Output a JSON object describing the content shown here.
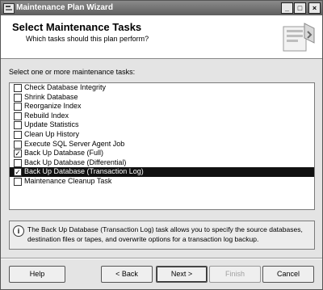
{
  "window": {
    "title": "Maintenance Plan Wizard"
  },
  "window_controls": {
    "minimize": "_",
    "maximize": "□",
    "close": "×"
  },
  "header": {
    "heading": "Select Maintenance Tasks",
    "subheading": "Which tasks should this plan perform?"
  },
  "tasks": {
    "instruction": "Select one or more maintenance tasks:",
    "items": [
      {
        "label": "Check Database Integrity",
        "checked": false
      },
      {
        "label": "Shrink Database",
        "checked": false
      },
      {
        "label": "Reorganize Index",
        "checked": false
      },
      {
        "label": "Rebuild Index",
        "checked": false
      },
      {
        "label": "Update Statistics",
        "checked": false
      },
      {
        "label": "Clean Up History",
        "checked": false
      },
      {
        "label": "Execute SQL Server Agent Job",
        "checked": false
      },
      {
        "label": "Back Up Database (Full)",
        "checked": true
      },
      {
        "label": "Back Up Database (Differential)",
        "checked": false
      },
      {
        "label": "Back Up Database (Transaction Log)",
        "checked": true,
        "selected": true
      },
      {
        "label": "Maintenance Cleanup Task",
        "checked": false
      }
    ]
  },
  "info": {
    "icon": "info-icon",
    "text": "The Back Up Database (Transaction Log) task allows you to specify the source databases, destination files or tapes, and overwrite options for a transaction log backup."
  },
  "buttons": {
    "help": "Help",
    "back": "< Back",
    "next": "Next >",
    "finish": "Finish",
    "cancel": "Cancel"
  }
}
